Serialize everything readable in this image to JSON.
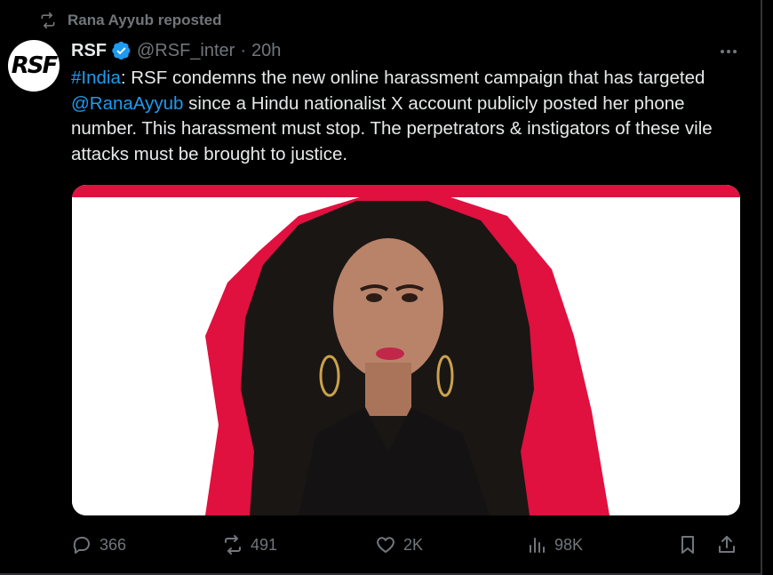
{
  "repost": {
    "icon": "repost-icon",
    "label": "Rana Ayyub reposted"
  },
  "author": {
    "avatar_text": "RSF",
    "name": "RSF",
    "handle": "@RSF_inter",
    "separator": "·",
    "time": "20h",
    "verified_color": "#1d9bf0"
  },
  "tweet": {
    "hashtag": "#India",
    "part1": ": RSF condemns the new online harassment campaign that has targeted ",
    "mention": "@RanaAyyub",
    "part2": " since a Hindu nationalist X account publicly posted her phone number. This harassment must stop. The perpetrators & instigators of these vile attacks must be brought to justice."
  },
  "actions": {
    "replies": "366",
    "reposts": "491",
    "likes": "2K",
    "views": "98K"
  },
  "colors": {
    "accent": "#1d9bf0",
    "image_red": "#e0103f",
    "muted": "#71767b"
  }
}
